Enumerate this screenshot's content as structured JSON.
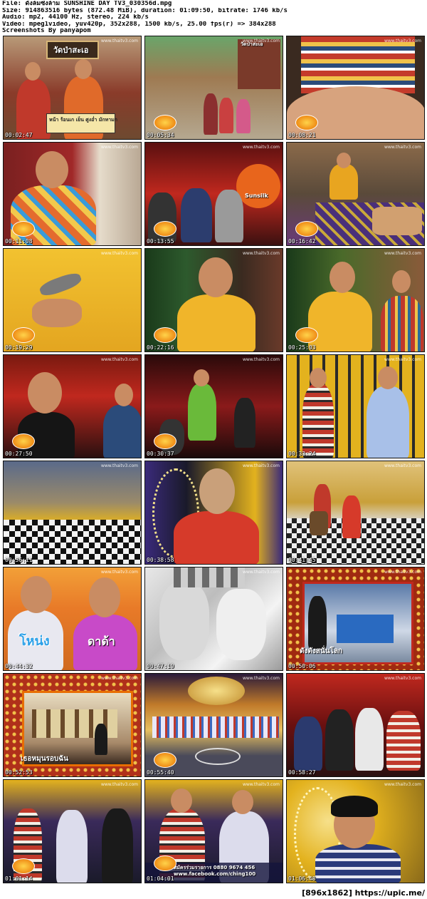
{
  "header": {
    "line1": "File: ดังล้มซึงล้าม SUNSHINE DAY TV3_030356d.mpg",
    "line2": "Size: 914863516 bytes (872.48 MiB), duration: 01:09:50, bitrate: 1746 kb/s",
    "line3": "Audio: mp2, 44100 Hz, stereo, 224 kb/s",
    "line4": "Video: mpeg1video, yuv420p, 352x288, 1500 kb/s, 25.00 fps(r) => 384x288",
    "line5": "Screenshots By panyapom"
  },
  "channel_logo": "www.thaitv3.com",
  "thumbnails": [
    {
      "ts": "00:02:47",
      "caption": "วัดป่าสะเอ"
    },
    {
      "ts": "00:05:34",
      "caption": "วัดป่าสะเอ"
    },
    {
      "ts": "00:08:21",
      "caption": ""
    },
    {
      "ts": "00:11:08",
      "caption": ""
    },
    {
      "ts": "00:13:55",
      "caption": "Sunsilk"
    },
    {
      "ts": "00:16:42",
      "caption": ""
    },
    {
      "ts": "00:19:29",
      "caption": ""
    },
    {
      "ts": "00:22:16",
      "caption": ""
    },
    {
      "ts": "00:25:03",
      "caption": ""
    },
    {
      "ts": "00:27:50",
      "caption": ""
    },
    {
      "ts": "00:30:37",
      "caption": ""
    },
    {
      "ts": "00:33:24",
      "caption": ""
    },
    {
      "ts": "00:36:11",
      "caption": ""
    },
    {
      "ts": "00:38:58",
      "caption": ""
    },
    {
      "ts": "00:41:45",
      "caption": ""
    },
    {
      "ts": "00:44:32",
      "caption": "โหน่ง"
    },
    {
      "ts": "00:47:19",
      "caption": ""
    },
    {
      "ts": "00:50:06",
      "caption": "ดังดังสนั่นโลก"
    },
    {
      "ts": "00:52:53",
      "caption": "เธอหมุนรอบฉัน"
    },
    {
      "ts": "00:55:40",
      "caption": ""
    },
    {
      "ts": "00:58:27",
      "caption": ""
    },
    {
      "ts": "01:01:14",
      "caption": ""
    },
    {
      "ts": "01:04:01",
      "caption": "สมัครร่วมรายการ 0880 9674 456"
    },
    {
      "ts": "01:06:48",
      "caption": ""
    }
  ],
  "thumb16_caption2": "ดาด้า",
  "thumb23_caption2": "www.facebook.com/ching100",
  "thumb1_sign": "หน้า ร้อนเก เย็น ศูงอ่ำ มักทามก",
  "footer": "[896x1862] https://upic.me/"
}
